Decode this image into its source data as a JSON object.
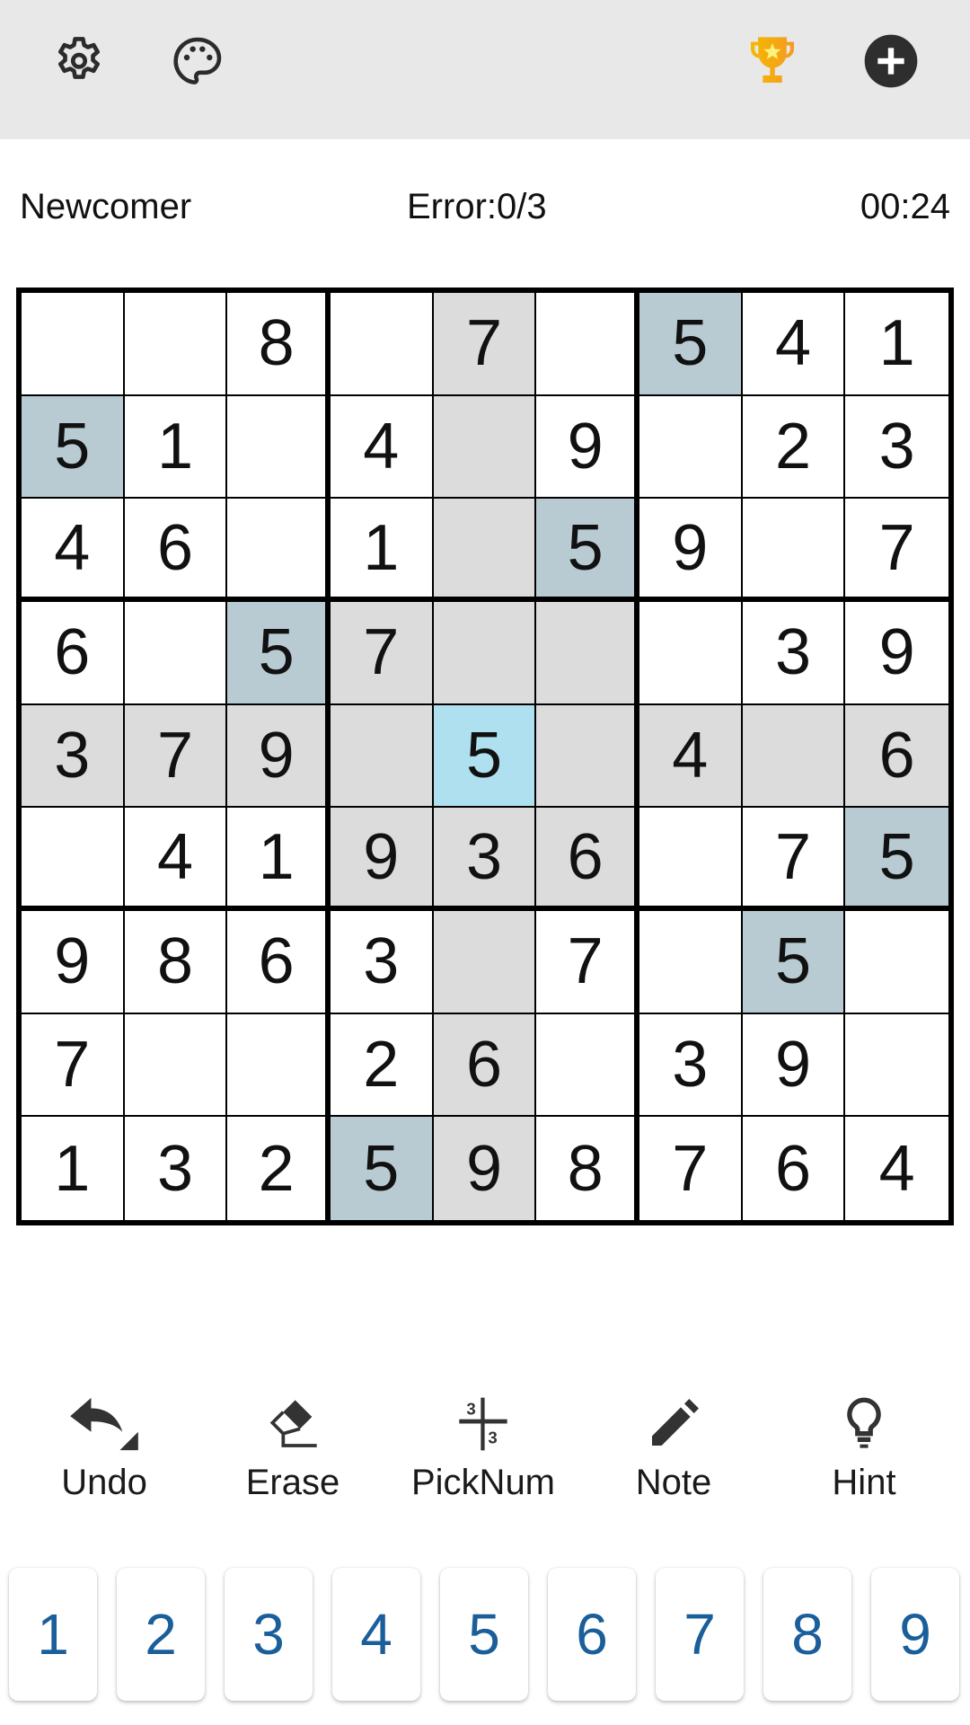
{
  "topbar": {
    "icons": [
      "gear-icon",
      "palette-icon",
      "trophy-icon",
      "plus-circle-icon"
    ]
  },
  "status": {
    "level": "Newcomer",
    "errors": "Error:0/3",
    "timer": "00:24"
  },
  "colors": {
    "selected": "#aee0f0",
    "same_number": "#b8cbd2",
    "related": "#dcdcdc",
    "numpad_text": "#1a5e9a",
    "trophy": "#f5a623"
  },
  "board": {
    "selected": [
      4,
      4
    ],
    "grid": [
      [
        "",
        "",
        "8",
        "",
        "7",
        "",
        "5",
        "4",
        "1"
      ],
      [
        "5",
        "1",
        "",
        "4",
        "",
        "9",
        "",
        "2",
        "3"
      ],
      [
        "4",
        "6",
        "",
        "1",
        "",
        "5",
        "9",
        "",
        "7"
      ],
      [
        "6",
        "",
        "5",
        "7",
        "",
        "",
        "",
        "3",
        "9"
      ],
      [
        "3",
        "7",
        "9",
        "",
        "5",
        "",
        "4",
        "",
        "6"
      ],
      [
        "",
        "4",
        "1",
        "9",
        "3",
        "6",
        "",
        "7",
        "5"
      ],
      [
        "9",
        "8",
        "6",
        "3",
        "",
        "7",
        "",
        "5",
        ""
      ],
      [
        "7",
        "",
        "",
        "2",
        "6",
        "",
        "3",
        "9",
        ""
      ],
      [
        "1",
        "3",
        "2",
        "5",
        "9",
        "8",
        "7",
        "6",
        "4"
      ]
    ]
  },
  "tools": [
    {
      "label": "Undo",
      "icon": "undo-icon"
    },
    {
      "label": "Erase",
      "icon": "eraser-icon"
    },
    {
      "label": "PickNum",
      "icon": "picknum-icon"
    },
    {
      "label": "Note",
      "icon": "pencil-icon"
    },
    {
      "label": "Hint",
      "icon": "lightbulb-icon"
    }
  ],
  "numpad": [
    "1",
    "2",
    "3",
    "4",
    "5",
    "6",
    "7",
    "8",
    "9"
  ]
}
